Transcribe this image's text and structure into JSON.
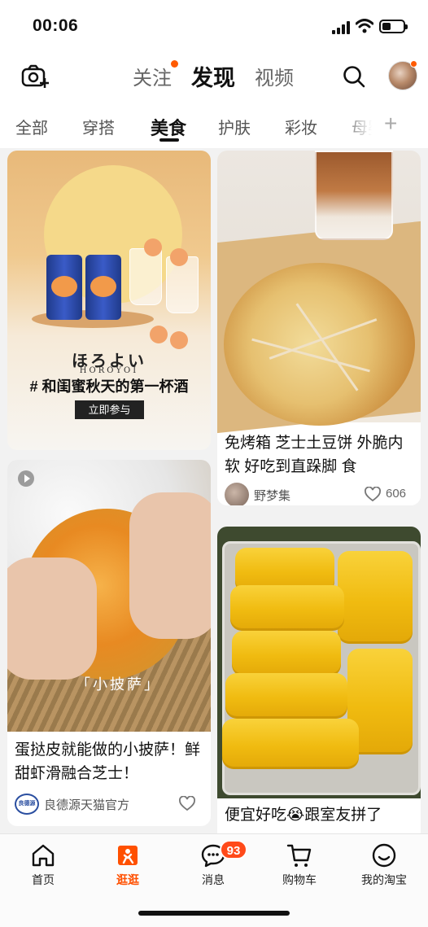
{
  "status_bar": {
    "time": "00:06"
  },
  "header": {
    "tabs": [
      {
        "label": "关注"
      },
      {
        "label": "发现"
      },
      {
        "label": "视频"
      }
    ]
  },
  "categories": [
    {
      "label": "全部"
    },
    {
      "label": "穿搭"
    },
    {
      "label": "美食"
    },
    {
      "label": "护肤"
    },
    {
      "label": "彩妆"
    },
    {
      "label": "母婴"
    }
  ],
  "feed": {
    "ad_card": {
      "brand": "ほろよい",
      "brand_sub": "HOROYOI",
      "title": "# 和闺蜜秋天的第一杯酒",
      "cta": "立即参与"
    },
    "post_pancake": {
      "title": "免烤箱  芝士土豆饼 外脆内软 好吃到直跺脚 食",
      "user": "野梦集",
      "likes": "606"
    },
    "post_pizza": {
      "caption": "「小披萨」",
      "title": "蛋挞皮就能做的小披萨！鲜甜虾滑融合芝士！",
      "user": "良德源天猫官方",
      "brand_logo": "良德源"
    },
    "post_rolls": {
      "title": "便宜好吃😭跟室友拼了"
    }
  },
  "bottom_nav": {
    "items": [
      {
        "label": "首页",
        "icon": "home-icon"
      },
      {
        "label": "逛逛",
        "icon": "discover-icon"
      },
      {
        "label": "消息",
        "icon": "message-icon",
        "badge": "93"
      },
      {
        "label": "购物车",
        "icon": "cart-icon"
      },
      {
        "label": "我的淘宝",
        "icon": "profile-icon"
      }
    ]
  },
  "colors": {
    "accent": "#ff5000",
    "badge": "#ff4a1a"
  }
}
